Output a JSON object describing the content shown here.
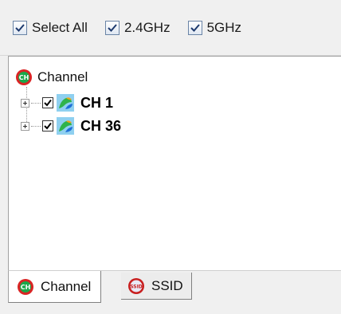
{
  "toolbar": {
    "select_all": {
      "label": "Select All",
      "checked": true
    },
    "band_24": {
      "label": "2.4GHz",
      "checked": true
    },
    "band_5": {
      "label": "5GHz",
      "checked": true
    }
  },
  "tree": {
    "root": {
      "label": "Channel",
      "icon": "channel-icon"
    },
    "nodes": [
      {
        "label": "CH 1",
        "checked": true,
        "icon": "channel-node-icon"
      },
      {
        "label": "CH 36",
        "checked": true,
        "icon": "channel-node-icon"
      }
    ]
  },
  "tabs": [
    {
      "label": "Channel",
      "icon": "channel-icon",
      "active": true
    },
    {
      "label": "SSID",
      "icon": "ssid-icon",
      "active": false
    }
  ],
  "colors": {
    "channel_icon_green": "#1aa84a",
    "channel_icon_red": "#d92424",
    "ssid_icon_red": "#c81e1e",
    "node_icon_green": "#2fb34a",
    "node_icon_blue": "#1f70d8",
    "node_icon_orange": "#f4a418"
  }
}
